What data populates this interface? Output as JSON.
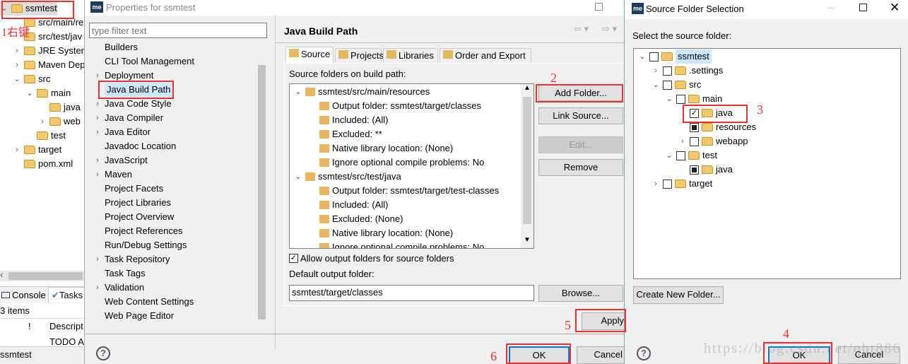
{
  "explorer": {
    "items": [
      {
        "label": "ssmtest",
        "depth": 0,
        "chev": "v"
      },
      {
        "label": "src/main/re",
        "depth": 1,
        "chev": ""
      },
      {
        "label": "src/test/jav",
        "depth": 1,
        "chev": ""
      },
      {
        "label": "JRE System",
        "depth": 1,
        "chev": ">"
      },
      {
        "label": "Maven Dep",
        "depth": 1,
        "chev": ">"
      },
      {
        "label": "src",
        "depth": 1,
        "chev": "v"
      },
      {
        "label": "main",
        "depth": 2,
        "chev": "v"
      },
      {
        "label": "java",
        "depth": 3,
        "chev": ""
      },
      {
        "label": "web",
        "depth": 3,
        "chev": ">"
      },
      {
        "label": "test",
        "depth": 2,
        "chev": ""
      },
      {
        "label": "target",
        "depth": 1,
        "chev": ">"
      },
      {
        "label": "pom.xml",
        "depth": 1,
        "chev": ""
      }
    ],
    "tabs": [
      "Console",
      "Tasks"
    ],
    "count": "3 items",
    "columns": [
      "!",
      "Descript"
    ],
    "row": "TODO A",
    "status": "ssmtest"
  },
  "properties": {
    "title": "Properties for ssmtest",
    "filter_placeholder": "type filter text",
    "nav": [
      {
        "label": "Builders",
        "chev": ""
      },
      {
        "label": "CLI Tool Management",
        "chev": ""
      },
      {
        "label": "Deployment",
        "chev": ">"
      },
      {
        "label": "Java Build Path",
        "chev": "",
        "selected": true
      },
      {
        "label": "Java Code Style",
        "chev": ">"
      },
      {
        "label": "Java Compiler",
        "chev": ">"
      },
      {
        "label": "Java Editor",
        "chev": ">"
      },
      {
        "label": "Javadoc Location",
        "chev": ""
      },
      {
        "label": "JavaScript",
        "chev": ">"
      },
      {
        "label": "Maven",
        "chev": ">"
      },
      {
        "label": "Project Facets",
        "chev": ""
      },
      {
        "label": "Project Libraries",
        "chev": ""
      },
      {
        "label": "Project Overview",
        "chev": ""
      },
      {
        "label": "Project References",
        "chev": ""
      },
      {
        "label": "Run/Debug Settings",
        "chev": ""
      },
      {
        "label": "Task Repository",
        "chev": ">"
      },
      {
        "label": "Task Tags",
        "chev": ""
      },
      {
        "label": "Validation",
        "chev": ">"
      },
      {
        "label": "Web Content Settings",
        "chev": ""
      },
      {
        "label": "Web Page Editor",
        "chev": ""
      }
    ],
    "page_title": "Java Build Path",
    "tabs": [
      "Source",
      "Projects",
      "Libraries",
      "Order and Export"
    ],
    "source_label": "Source folders on build path:",
    "tree": [
      {
        "label": "ssmtest/src/main/resources",
        "depth": 0
      },
      {
        "label": "Output folder: ssmtest/target/classes",
        "depth": 1
      },
      {
        "label": "Included: (All)",
        "depth": 1
      },
      {
        "label": "Excluded: **",
        "depth": 1
      },
      {
        "label": "Native library location: (None)",
        "depth": 1
      },
      {
        "label": "Ignore optional compile problems: No",
        "depth": 1
      },
      {
        "label": "ssmtest/src/test/java",
        "depth": 0
      },
      {
        "label": "Output folder: ssmtest/target/test-classes",
        "depth": 1
      },
      {
        "label": "Included: (All)",
        "depth": 1
      },
      {
        "label": "Excluded: (None)",
        "depth": 1
      },
      {
        "label": "Native library location: (None)",
        "depth": 1
      },
      {
        "label": "Ignore optional compile problems: No",
        "depth": 1
      }
    ],
    "buttons": {
      "add": "Add Folder...",
      "link": "Link Source...",
      "edit": "Edit...",
      "remove": "Remove",
      "browse": "Browse...",
      "apply": "Apply",
      "ok": "OK",
      "cancel": "Cancel"
    },
    "allow_output": "Allow output folders for source folders",
    "allow_output_checked": true,
    "default_output_label": "Default output folder:",
    "default_output_value": "ssmtest/target/classes"
  },
  "selection": {
    "title": "Source Folder Selection",
    "prompt": "Select the source folder:",
    "tree": [
      {
        "label": "ssmtest",
        "depth": 0,
        "chev": "v",
        "state": "off"
      },
      {
        "label": ".settings",
        "depth": 1,
        "chev": ">",
        "state": "off"
      },
      {
        "label": "src",
        "depth": 1,
        "chev": "v",
        "state": "off"
      },
      {
        "label": "main",
        "depth": 2,
        "chev": "v",
        "state": "off"
      },
      {
        "label": "java",
        "depth": 3,
        "chev": "",
        "state": "checked"
      },
      {
        "label": "resources",
        "depth": 3,
        "chev": "",
        "state": "partial"
      },
      {
        "label": "webapp",
        "depth": 3,
        "chev": ">",
        "state": "off"
      },
      {
        "label": "test",
        "depth": 2,
        "chev": "v",
        "state": "off"
      },
      {
        "label": "java",
        "depth": 3,
        "chev": "",
        "state": "partial"
      },
      {
        "label": "target",
        "depth": 1,
        "chev": ">",
        "state": "off"
      }
    ],
    "create": "Create New Folder...",
    "ok": "OK",
    "cancel": "Cancel"
  },
  "annotations": {
    "n1": "1右键",
    "n2": "2",
    "n3": "3",
    "n4": "4",
    "n5": "5",
    "n6": "6"
  },
  "watermark": "https://blog.csdn.net/qht886",
  "colors": {
    "annotation": "#f03030",
    "selection": "#cce8ff",
    "default_button": "#0078d7"
  }
}
